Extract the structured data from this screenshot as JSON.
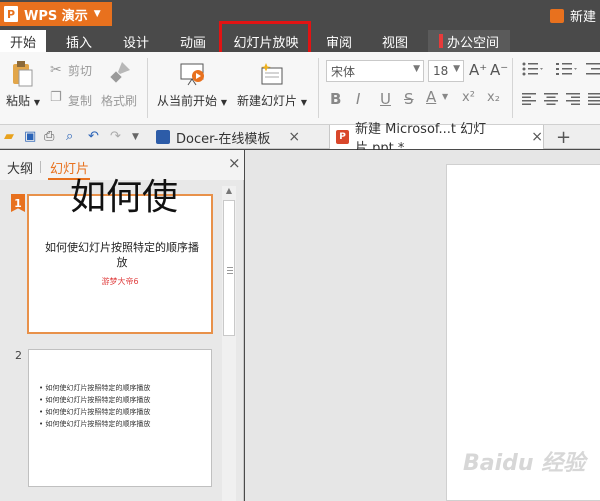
{
  "app": {
    "name": "WPS 演示",
    "new_label": "新建"
  },
  "menu": {
    "tabs": [
      "开始",
      "插入",
      "设计",
      "动画",
      "幻灯片放映",
      "审阅",
      "视图",
      "办公空间"
    ],
    "active": "开始"
  },
  "ribbon": {
    "paste": "粘贴",
    "cut": "剪切",
    "copy": "复制",
    "format_painter": "格式刷",
    "from_current": "从当前开始",
    "new_slide": "新建幻灯片",
    "font_name": "宋体",
    "font_size": "18",
    "bold": "B",
    "italic": "I",
    "underline": "U",
    "strike": "S",
    "font_color": "A",
    "superscript": "x²",
    "subscript": "x₂",
    "grow_font": "A⁺",
    "shrink_font": "A⁻"
  },
  "doctabs": {
    "docer": "Docer-在线模板",
    "current": "新建 Microsof...t 幻灯片.ppt *",
    "close": "×",
    "add": "+"
  },
  "panel": {
    "tab_outline": "大纲",
    "tab_slides": "幻灯片",
    "close": "×"
  },
  "slides": [
    {
      "number": "1",
      "title": "如何使幻灯片按照特定的顺序播放",
      "subtitle": "游梦大帝6"
    },
    {
      "number": "2",
      "bullets": [
        "如何使幻灯片按照特定的顺序播放",
        "如何使幻灯片按照特定的顺序播放",
        "如何使幻灯片按照特定的顺序播放",
        "如何使幻灯片按照特定的顺序播放"
      ]
    }
  ],
  "main_slide": {
    "title": "如何使"
  },
  "watermark": "Baidu 经验",
  "colors": {
    "accent": "#e8711e",
    "highlight": "#e21313",
    "titlebar": "#4a4a4a"
  }
}
